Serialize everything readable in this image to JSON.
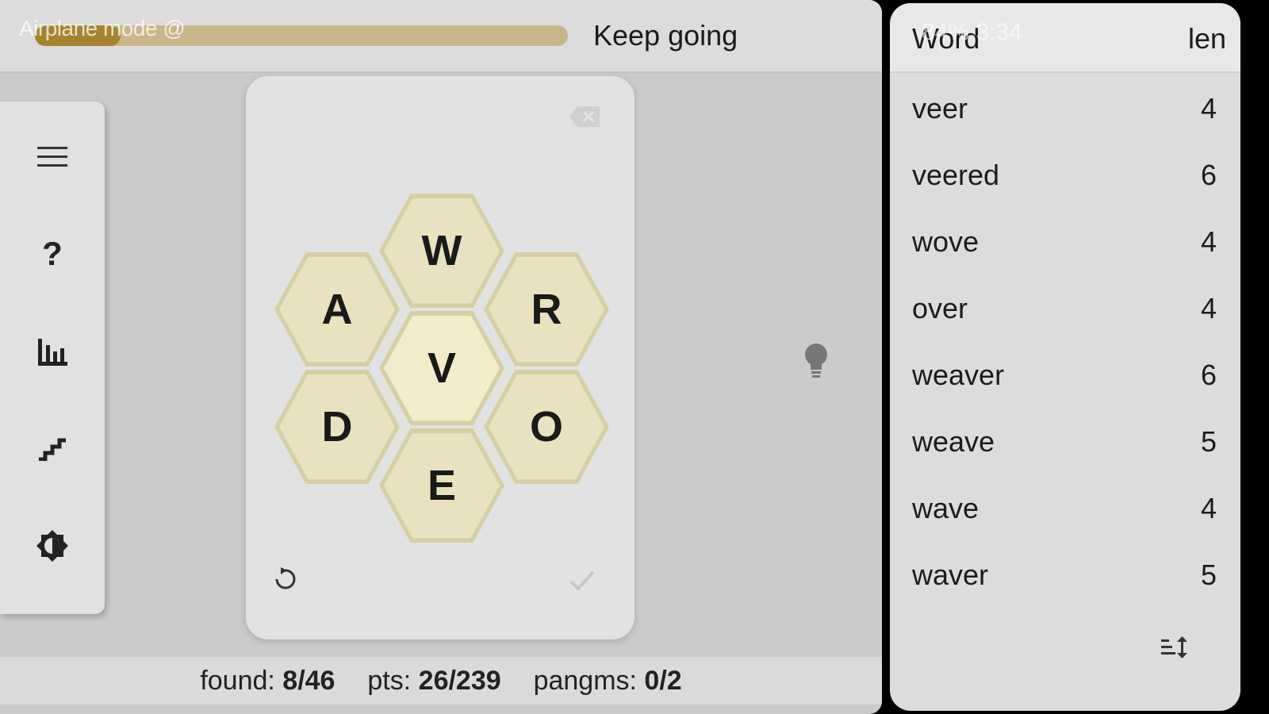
{
  "status_left": "Airplane mode @",
  "status_right": "84%  3:34",
  "progress": {
    "fraction": 0.16,
    "rank_label": "Keep going"
  },
  "sidebar": {
    "items": [
      {
        "icon": "menu-icon"
      },
      {
        "icon": "help-icon",
        "label": "?"
      },
      {
        "icon": "stats-icon"
      },
      {
        "icon": "ranks-icon"
      },
      {
        "icon": "theme-icon"
      }
    ]
  },
  "board": {
    "letters": {
      "top": "W",
      "upper_left": "A",
      "upper_right": "R",
      "center": "V",
      "lower_left": "D",
      "lower_right": "O",
      "bottom": "E"
    }
  },
  "stats": {
    "found_label": "found:",
    "found_value": "8/46",
    "pts_label": "pts:",
    "pts_value": "26/239",
    "pangrams_label": "pangms:",
    "pangrams_value": "0/2"
  },
  "wordlist": {
    "header_word": "Word",
    "header_len": "len",
    "rows": [
      {
        "word": "veer",
        "len": "4"
      },
      {
        "word": "veered",
        "len": "6"
      },
      {
        "word": "wove",
        "len": "4"
      },
      {
        "word": "over",
        "len": "4"
      },
      {
        "word": "weaver",
        "len": "6"
      },
      {
        "word": "weave",
        "len": "5"
      },
      {
        "word": "wave",
        "len": "4"
      },
      {
        "word": "waver",
        "len": "5"
      }
    ]
  },
  "colors": {
    "progress_fill": "#a8832f",
    "progress_track": "#c9b68b",
    "hex_outer": "#d6cfa4",
    "hex_inner": "#e9e1bf",
    "hex_center": "#f3ebca"
  }
}
